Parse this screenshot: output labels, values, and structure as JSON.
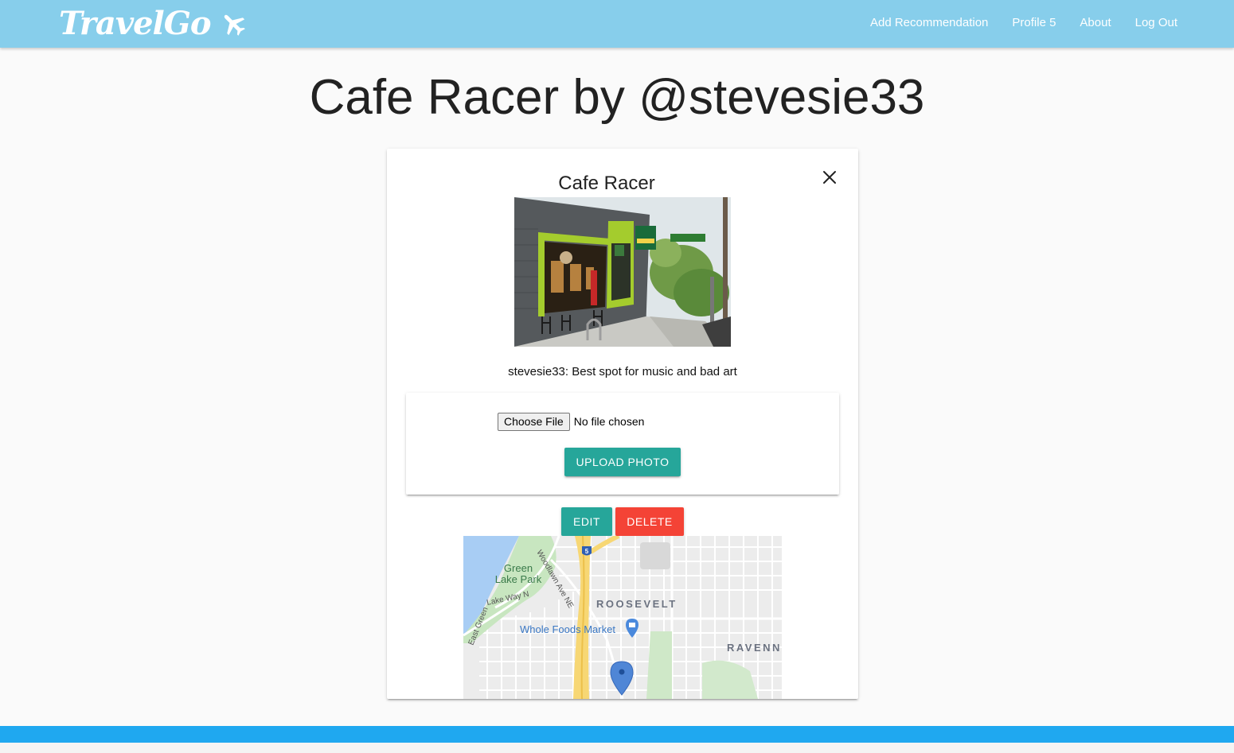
{
  "navbar": {
    "brand": "TravelGo",
    "brand_icon": "airplane-icon",
    "links": [
      {
        "label": "Add Recommendation"
      },
      {
        "label": "Profile 5"
      },
      {
        "label": "About"
      },
      {
        "label": "Log Out"
      }
    ],
    "color": "#87ceeb"
  },
  "page": {
    "title": "Cafe Racer by @stevesie33"
  },
  "card": {
    "title": "Cafe Racer",
    "close_icon": "close-icon",
    "photo_description": "cafe-storefront-photo",
    "caption": "stevesie33: Best spot for music and bad art",
    "upload": {
      "choose_file_label": "Choose File",
      "file_status": "No file chosen",
      "upload_label": "UPLOAD PHOTO"
    },
    "actions": {
      "edit_label": "EDIT",
      "delete_label": "DELETE"
    },
    "map": {
      "labels": {
        "park_line1": "Green",
        "park_line2": "Lake Park",
        "woodlawn": "Woodlawn Ave NE",
        "lake_way": "Lake Way N",
        "east_green": "East Green",
        "interstate": "5",
        "roosevelt": "ROOSEVELT",
        "whole_foods": "Whole Foods Market",
        "ravenna": "RAVENN"
      }
    }
  },
  "colors": {
    "primary": "#26a69a",
    "danger": "#f44336",
    "footer": "#1fa8f0"
  }
}
